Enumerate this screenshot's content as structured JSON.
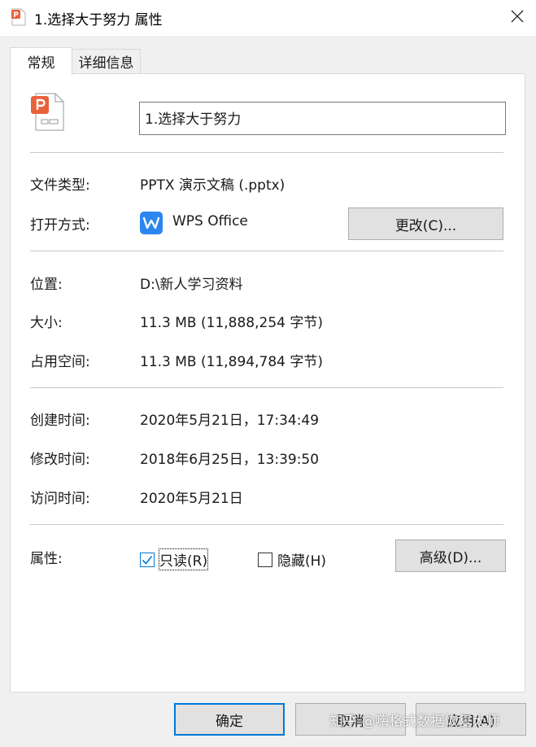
{
  "window": {
    "title": "1.选择大于努力 属性",
    "close_icon": "close-icon",
    "file_icon": "pptx-file-icon"
  },
  "tabs": [
    {
      "label": "常规",
      "selected": true
    },
    {
      "label": "详细信息",
      "selected": false
    }
  ],
  "general": {
    "filename": "1.选择大于努力",
    "file_type_label": "文件类型:",
    "file_type_value": "PPTX 演示文稿 (.pptx)",
    "opens_with_label": "打开方式:",
    "opens_with_value": "WPS Office",
    "opens_with_icon": "wps-office-icon",
    "change_button": "更改(C)...",
    "location_label": "位置:",
    "location_value": "D:\\新人学习资料",
    "size_label": "大小:",
    "size_value": "11.3 MB (11,888,254 字节)",
    "size_on_disk_label": "占用空间:",
    "size_on_disk_value": "11.3 MB (11,894,784 字节)",
    "created_label": "创建时间:",
    "created_value": "2020年5月21日，17:34:49",
    "modified_label": "修改时间:",
    "modified_value": "2018年6月25日，13:39:50",
    "accessed_label": "访问时间:",
    "accessed_value": "2020年5月21日",
    "attributes_label": "属性:",
    "readonly_label": "只读(R)",
    "readonly_checked": true,
    "hidden_label": "隐藏(H)",
    "hidden_checked": false,
    "advanced_button": "高级(D)..."
  },
  "footer": {
    "ok_button": "确定",
    "cancel_button": "取消",
    "apply_button": "应用(A)"
  },
  "watermark": "知乎 @嗨格式数据恢复大师",
  "colors": {
    "accent": "#0078d7",
    "pptx_orange": "#e8623a",
    "wps_blue": "#2b86f0"
  }
}
